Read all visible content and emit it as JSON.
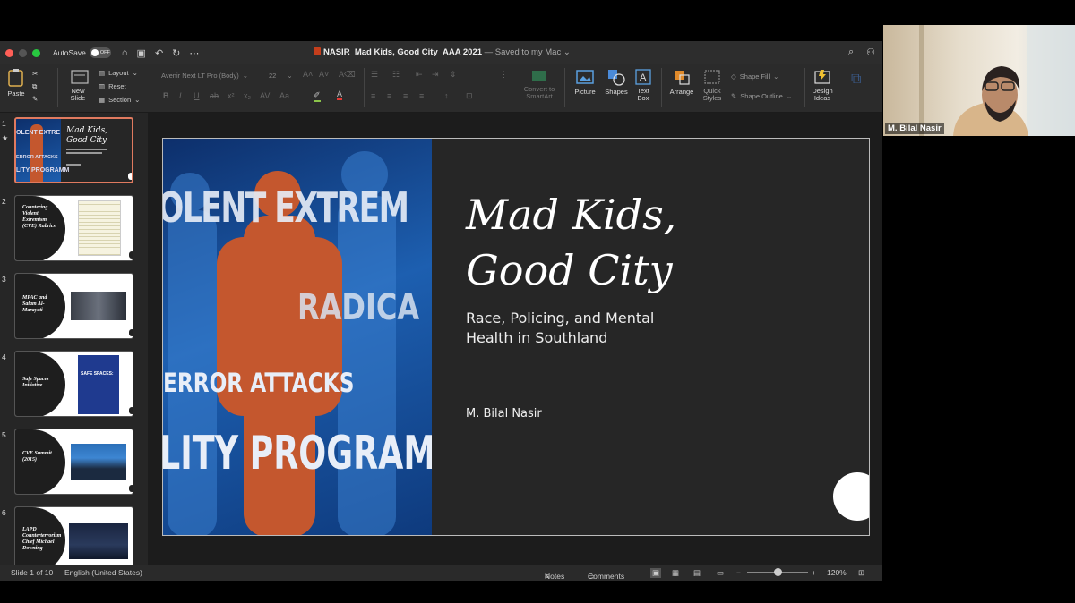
{
  "window": {
    "autosave_label": "AutoSave",
    "autosave_state": "OFF",
    "doc_name": "NASIR_Mad Kids, Good City_AAA 2021",
    "doc_status": "— Saved to my Mac"
  },
  "ribbon": {
    "paste": "Paste",
    "new_slide": "New Slide",
    "layout": "Layout",
    "reset": "Reset",
    "section": "Section",
    "font_name": "Avenir Next LT Pro (Body)",
    "font_size": "22",
    "convert_smartart": "Convert to SmartArt",
    "picture": "Picture",
    "shapes": "Shapes",
    "text_box": "Text Box",
    "arrange": "Arrange",
    "quick_styles": "Quick Styles",
    "shape_fill": "Shape Fill",
    "shape_outline": "Shape Outline",
    "design_ideas": "Design Ideas"
  },
  "thumbnails": [
    {
      "num": "1",
      "title": "Mad Kids, Good City"
    },
    {
      "num": "2",
      "title": "Countering Violent Extremism (CVE) Rubrics"
    },
    {
      "num": "3",
      "title": "MPAC and Salam Al-Marayati"
    },
    {
      "num": "4",
      "title": "Safe Spaces Initiative",
      "image_text": "SAFE SPACES:"
    },
    {
      "num": "5",
      "title": "CVE Summit (2015)"
    },
    {
      "num": "6",
      "title": "LAPD Counterterrorism Chief Michael Downing"
    }
  ],
  "slide": {
    "image_text": [
      "OLENT EXTREM",
      "RADICA",
      "ERROR ATTACKS",
      "LITY PROGRAMM"
    ],
    "title_line1": "Mad Kids,",
    "title_line2": "Good City",
    "subtitle": "Race, Policing, and Mental Health in Southland",
    "author": "M. Bilal Nasir"
  },
  "status": {
    "slide_count": "Slide 1 of 10",
    "language": "English (United States)",
    "notes": "Notes",
    "comments": "Comments",
    "zoom": "120%"
  },
  "video": {
    "participant": "M. Bilal Nasir"
  }
}
